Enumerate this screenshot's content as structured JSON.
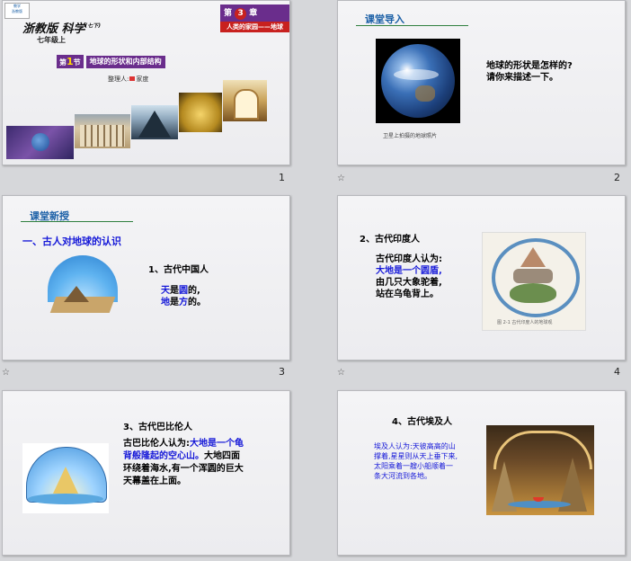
{
  "slides": [
    {
      "number": "1",
      "badge_line1": "教学",
      "badge_line2": "浙教版",
      "title": "浙教版 科学",
      "title_sup": "(七下)",
      "grade": "七年级上",
      "chapter_prefix": "第",
      "chapter_num": "3",
      "chapter_suffix": "章",
      "chapter_title": "人类的家园——地球",
      "section_prefix": "第",
      "section_num": "1",
      "section_suffix": "节",
      "section_title": "地球的形状和内部结构",
      "author_label": "整理人:",
      "author_name": "家度"
    },
    {
      "number": "2",
      "heading": "课堂导入",
      "caption": "卫星上拍摄的地球照片",
      "question_line1": "地球的形状是怎样的?",
      "question_line2": "请你来描述一下。"
    },
    {
      "number": "3",
      "heading": "课堂新授",
      "subheading": "一、古人对地球的认识",
      "item": "1、古代中国人",
      "line1_blue": "天",
      "line1_rest": "是",
      "line1_blue2": "圆",
      "line1_end": "的,",
      "line2_blue": "地",
      "line2_rest": "是",
      "line2_blue2": "方",
      "line2_end": "的。"
    },
    {
      "number": "4",
      "item": "2、古代印度人",
      "line1": "古代印度人认为:",
      "line2": "大地是一个圆盾,",
      "line3": "由几只大象驼着,",
      "line4": "站在乌龟背上。",
      "fig_caption": "图 2-1 古代印度人的地球观"
    },
    {
      "number": "",
      "item": "3、古代巴比伦人",
      "text_black1": "古巴比伦人认为:",
      "text_blue": "大地是一个龟背般隆起的空心山。",
      "text_black2": "大地四面环绕着海水,有一个浑圆的巨大天幕盖在上面。"
    },
    {
      "number": "",
      "item": "4、古代埃及人",
      "text": "埃及人认为:天彼高高的山撑着,星星则从天上垂下来,太阳乘着一艘小船顺着一条大河流到各地。"
    }
  ],
  "colors": {
    "heading_blue": "#1a5fa6",
    "text_blue": "#1518d8",
    "chapter_bg": "#6a2d8c",
    "chapter_title_bg": "#c8211f"
  }
}
